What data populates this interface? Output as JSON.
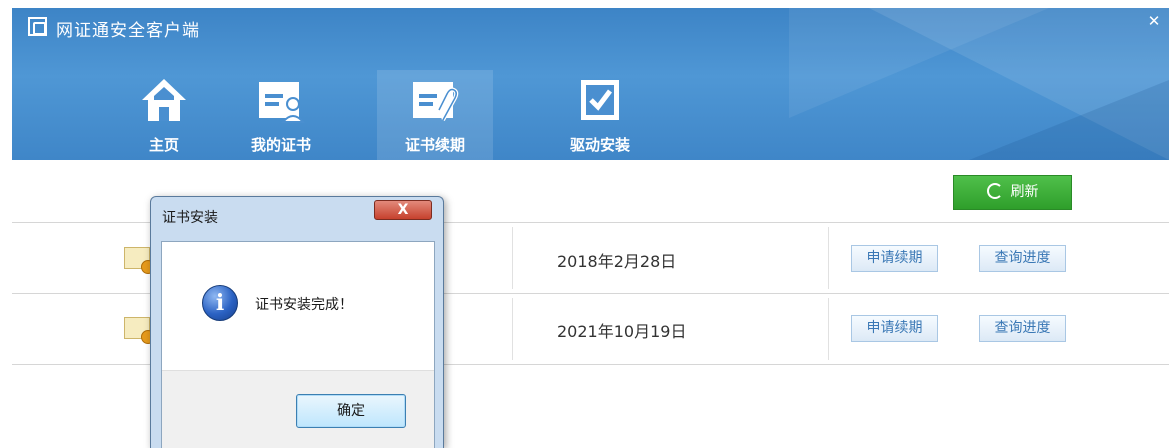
{
  "window": {
    "title": "网证通安全客户端",
    "close_glyph": "✕"
  },
  "nav": {
    "items": [
      {
        "label": "主页",
        "icon": "home-icon"
      },
      {
        "label": "我的证书",
        "icon": "certificate-user-icon"
      },
      {
        "label": "证书续期",
        "icon": "certificate-renew-icon",
        "active": true
      },
      {
        "label": "驱动安装",
        "icon": "driver-install-icon"
      }
    ]
  },
  "toolbar": {
    "refresh_label": "刷新"
  },
  "certificates": [
    {
      "expiry": "2018年2月28日",
      "renew_label": "申请续期",
      "progress_label": "查询进度"
    },
    {
      "expiry": "2021年10月19日",
      "renew_label": "申请续期",
      "progress_label": "查询进度"
    }
  ],
  "dialog": {
    "title": "证书安装",
    "close_glyph": "X",
    "icon": "info-icon",
    "info_glyph": "i",
    "message": "证书安装完成！",
    "ok_label": "确定"
  },
  "colors": {
    "header_blue": "#4a90d2",
    "refresh_green": "#3aad35",
    "dialog_close_red": "#c6412d"
  }
}
